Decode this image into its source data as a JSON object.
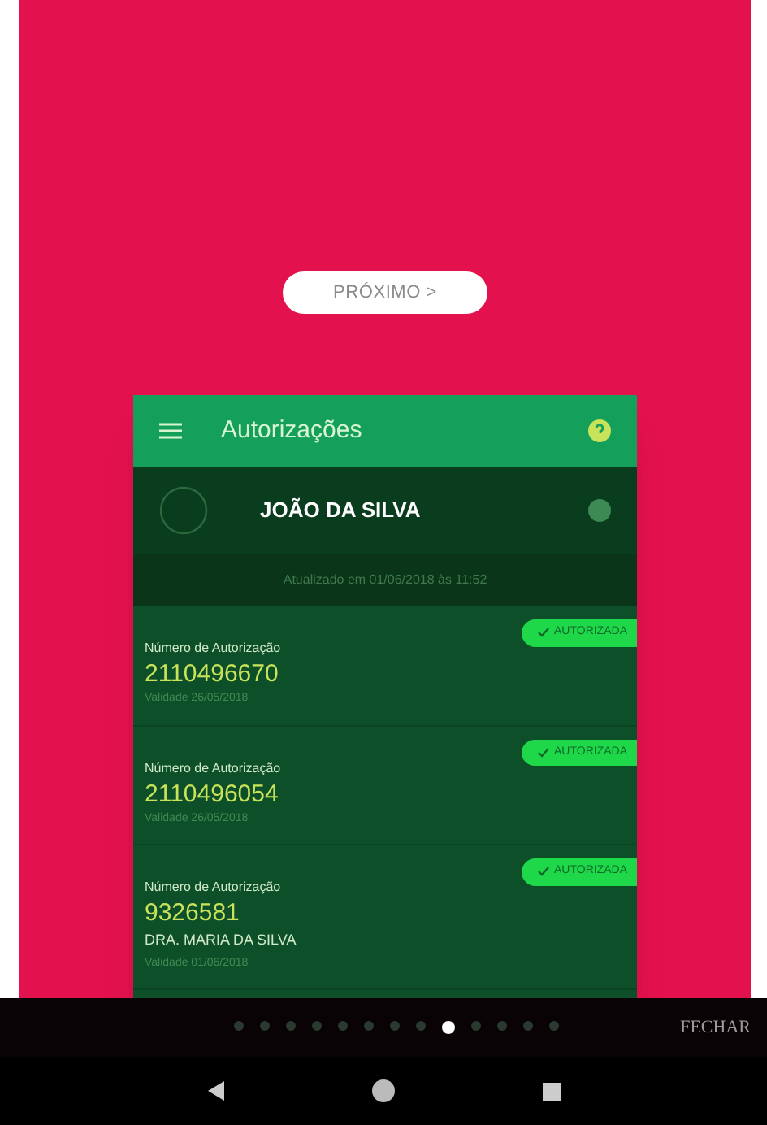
{
  "next_button": {
    "label": "PRÓXIMO >"
  },
  "app": {
    "title": "Autorizações",
    "user": {
      "name": "JOÃO DA SILVA",
      "updated": "Atualizado em 01/06/2018 às 11:52"
    },
    "authorizations": [
      {
        "label": "Número de Autorização",
        "number": "2110496670",
        "status": "AUTORIZADA",
        "validity": "Validade 26/05/2018"
      },
      {
        "label": "Número de Autorização",
        "number": "2110496054",
        "status": "AUTORIZADA",
        "validity": "Validade 26/05/2018"
      },
      {
        "label": "Número de Autorização",
        "number": "9326581",
        "status": "AUTORIZADA",
        "patient": "DRA. MARIA DA SILVA",
        "validity": "Validade 01/06/2018"
      }
    ]
  },
  "pager": {
    "dots": [
      {
        "selected": false
      },
      {
        "selected": false
      },
      {
        "selected": false
      },
      {
        "selected": false
      },
      {
        "selected": false
      },
      {
        "selected": false
      },
      {
        "selected": false
      },
      {
        "selected": false
      },
      {
        "selected": true
      },
      {
        "selected": false
      },
      {
        "selected": false
      },
      {
        "selected": false
      },
      {
        "selected": false
      }
    ],
    "close": "FECHAR"
  }
}
